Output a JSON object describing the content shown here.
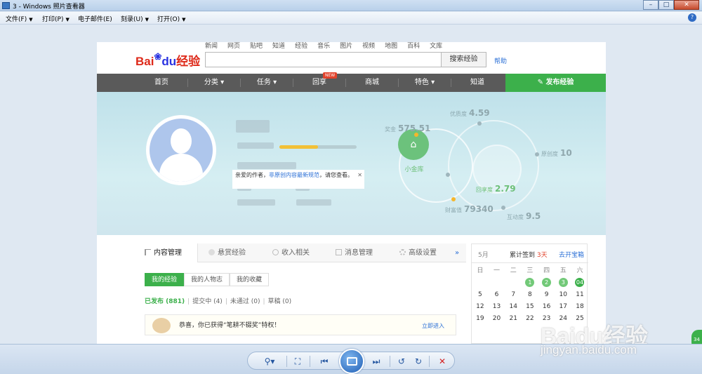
{
  "window": {
    "title": "3 - Windows 照片查看器",
    "controls": [
      "–",
      "□",
      "✕"
    ]
  },
  "menu": {
    "items": [
      "文件(F)",
      "打印(P)",
      "电子邮件(E)",
      "刻录(U)",
      "打开(O)"
    ],
    "help": "?"
  },
  "site": {
    "logo_bai": "Bai",
    "logo_du": "du",
    "logo_jingyan": "经验",
    "top_links": [
      "新闻",
      "网页",
      "贴吧",
      "知道",
      "经验",
      "音乐",
      "图片",
      "视频",
      "地图",
      "百科",
      "文库"
    ],
    "search_button": "搜索经验",
    "help_link": "帮助"
  },
  "nav": {
    "items": [
      "首页",
      "分类",
      "任务",
      "回享",
      "商城",
      "特色",
      "知道"
    ],
    "new_badge": "NEW",
    "publish": "发布经验"
  },
  "profile": {
    "level_num_1": "881",
    "level_num_2": "10",
    "gold_label": "小金库",
    "stats": {
      "reward_label": "奖金",
      "reward_value": "575.51",
      "quality_label": "优质度",
      "quality_value": "4.59",
      "original_label": "原创度",
      "original_value": "10",
      "share_label": "回享度",
      "share_value": "2.79",
      "wealth_label": "财富值",
      "wealth_value": "79340",
      "interact_label": "互动度",
      "interact_value": "9.5"
    },
    "notice_prefix": "亲爱的作者，",
    "notice_link": "非原创内容最新规范",
    "notice_suffix": "，请您查看。",
    "notice_close": "✕"
  },
  "tabs": [
    "内容管理",
    "悬赏经验",
    "收入相关",
    "消息管理",
    "高级设置"
  ],
  "tabs_more": "»",
  "subtabs": [
    "我的经验",
    "我的人物志",
    "我的收藏"
  ],
  "filters": {
    "published": "已发布 (881)",
    "submitting": "提交中 (4)",
    "rejected": "未通过 (0)",
    "draft": "草稿 (0)"
  },
  "award": {
    "text": "恭喜，你已获得“笔耕不辍奖”特权！",
    "more": "立即进入"
  },
  "calendar": {
    "month": "5月",
    "sign_prefix": "累计签到 ",
    "sign_days": "3天",
    "open_chest": "去开宝箱",
    "weekdays": [
      "日",
      "一",
      "二",
      "三",
      "四",
      "五",
      "六"
    ],
    "rows": [
      [
        "",
        "",
        "",
        "1",
        "2",
        "3",
        "04"
      ],
      [
        "5",
        "6",
        "7",
        "8",
        "9",
        "10",
        "11"
      ],
      [
        "12",
        "13",
        "14",
        "15",
        "16",
        "17",
        "18"
      ],
      [
        "19",
        "20",
        "21",
        "22",
        "23",
        "24",
        "25"
      ]
    ],
    "signed": [
      "1",
      "2",
      "3",
      "04"
    ]
  },
  "toolbar": {
    "zoom": "⚲▾",
    "fit": "⛶",
    "prev": "⏮",
    "next": "⏭",
    "rotate_ccw": "↺",
    "rotate_cw": "↻",
    "delete": "✕"
  },
  "watermark": {
    "brand": "Baidu经验",
    "url": "jingyan.baidu.com"
  },
  "side_bubble": "34"
}
